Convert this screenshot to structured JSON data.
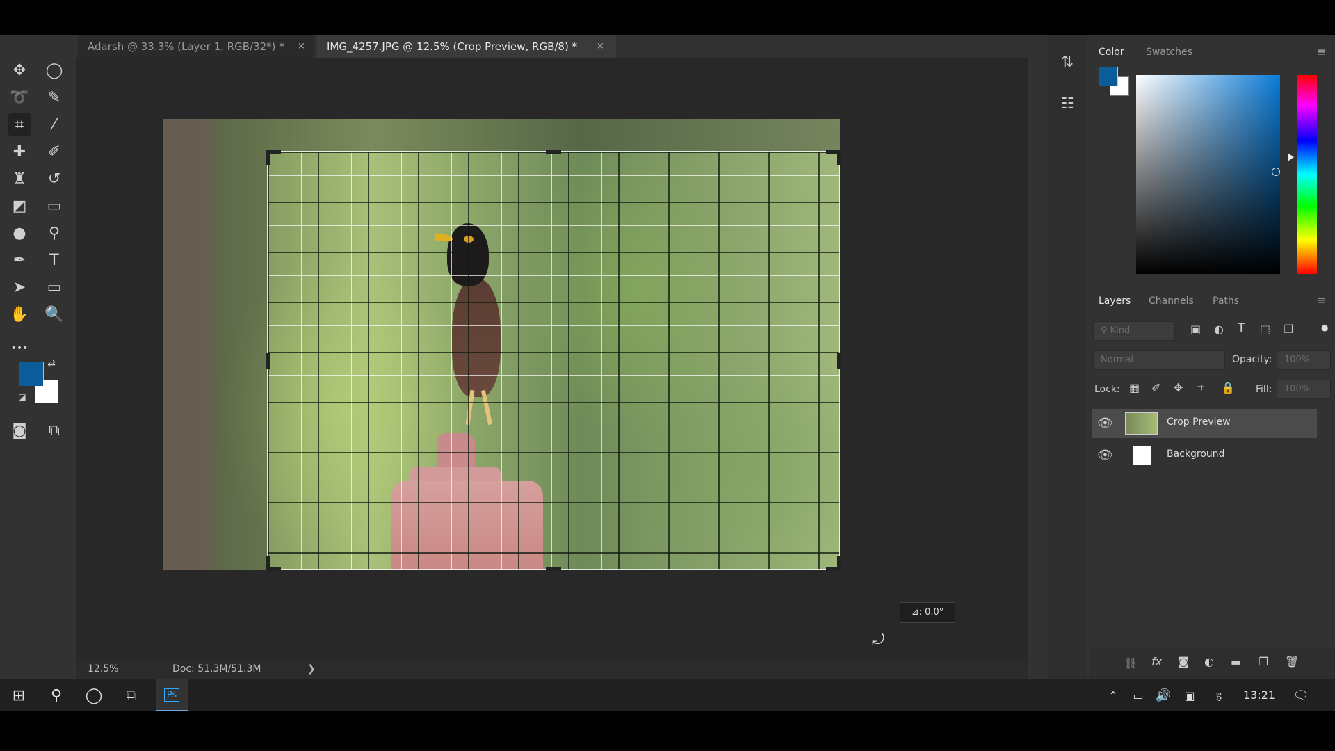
{
  "tabs": [
    {
      "label": "Adarsh @ 33.3% (Layer 1, RGB/32*) *",
      "close": "×"
    },
    {
      "label": "IMG_4257.JPG @ 12.5% (Crop Preview, RGB/8) *",
      "close": "×"
    }
  ],
  "tools": [
    {
      "name": "move-tool-icon",
      "glyph": "✥"
    },
    {
      "name": "ellipse-marquee-icon",
      "glyph": "◯"
    },
    {
      "name": "lasso-icon",
      "glyph": "➰"
    },
    {
      "name": "quick-select-icon",
      "glyph": "✎"
    },
    {
      "name": "crop-icon",
      "glyph": "⌗"
    },
    {
      "name": "eyedropper-icon",
      "glyph": "⁄"
    },
    {
      "name": "healing-brush-icon",
      "glyph": "✚"
    },
    {
      "name": "brush-icon",
      "glyph": "✐"
    },
    {
      "name": "clone-stamp-icon",
      "glyph": "♜"
    },
    {
      "name": "history-brush-icon",
      "glyph": "↺"
    },
    {
      "name": "eraser-icon",
      "glyph": "◩"
    },
    {
      "name": "gradient-icon",
      "glyph": "▭"
    },
    {
      "name": "blur-icon",
      "glyph": "●"
    },
    {
      "name": "dodge-icon",
      "glyph": "⚲"
    },
    {
      "name": "pen-icon",
      "glyph": "✒"
    },
    {
      "name": "type-icon",
      "glyph": "T"
    },
    {
      "name": "path-select-icon",
      "glyph": "➤"
    },
    {
      "name": "rectangle-icon",
      "glyph": "▭"
    },
    {
      "name": "hand-icon",
      "glyph": "✋"
    },
    {
      "name": "zoom-icon",
      "glyph": "🔍"
    },
    {
      "name": "more-tools-icon",
      "glyph": "•••"
    }
  ],
  "colors": {
    "foreground": "#0b5d9a",
    "background": "#ffffff",
    "accent": "#0a7bd6"
  },
  "angle_readout": "⊿: 0.0°",
  "status": {
    "zoom": "12.5%",
    "doc": "Doc: 51.3M/51.3M",
    "arrow": "❯"
  },
  "color_panel": {
    "tabs": [
      "Color",
      "Swatches"
    ],
    "active": "Color"
  },
  "layers_panel": {
    "tabs": [
      "Layers",
      "Channels",
      "Paths"
    ],
    "search_placeholder": "Kind",
    "blend_mode": "Normal",
    "opacity_label": "Opacity:",
    "opacity_value": "100%",
    "lock_label": "Lock:",
    "fill_label": "Fill:",
    "fill_value": "100%",
    "layers": [
      {
        "name": "Crop Preview",
        "selected": true
      },
      {
        "name": "Background",
        "selected": false
      }
    ],
    "footer_icons": [
      "link-icon",
      "fx-icon",
      "mask-icon",
      "adjustment-icon",
      "folder-icon",
      "new-layer-icon",
      "trash-icon"
    ],
    "footer_fx": "fx"
  },
  "taskbar": {
    "time": "13:21",
    "ps_label": "Ps"
  }
}
